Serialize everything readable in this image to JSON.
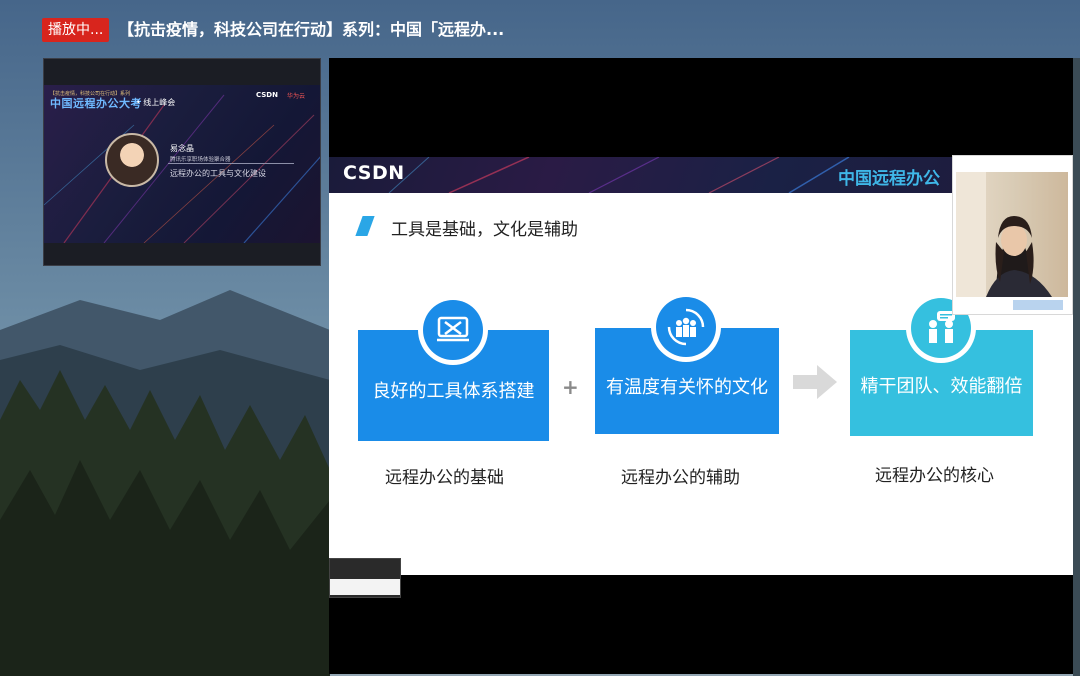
{
  "header": {
    "live_badge": "播放中...",
    "title": "【抗击疫情，科技公司在行动】系列：中国「远程办..."
  },
  "thumbnail": {
    "small_top": "【抗击疫情，科技公司在行动】系列",
    "headline": "中国远程办公大考",
    "headline_sub": "• 线上峰会",
    "csdn": "CSDN",
    "huawei": "华为云",
    "speaker_name": "易念晶",
    "speaker_role": "腾讯乐享职场体验聚合器",
    "talk_title": "远程办公的工具与文化建设"
  },
  "slide": {
    "logo": "CSDN",
    "banner_title": "中国远程办公",
    "heading": "工具是基础，文化是辅助",
    "cards": [
      {
        "label": "良好的工具体系搭建",
        "caption": "远程办公的基础",
        "color": "#1a8ce8",
        "icon": "tools-icon"
      },
      {
        "label": "有温度有关怀的文化",
        "caption": "远程办公的辅助",
        "color": "#1a8ce8",
        "icon": "people-cycle-icon"
      },
      {
        "label": "精干团队、效能翻倍",
        "caption": "远程办公的核心",
        "color": "#35c0df",
        "icon": "team-talk-icon"
      }
    ],
    "plus": "+"
  },
  "colors": {
    "live_red": "#d8251d",
    "card_blue": "#1a8ce8",
    "card_cyan": "#35c0df"
  }
}
